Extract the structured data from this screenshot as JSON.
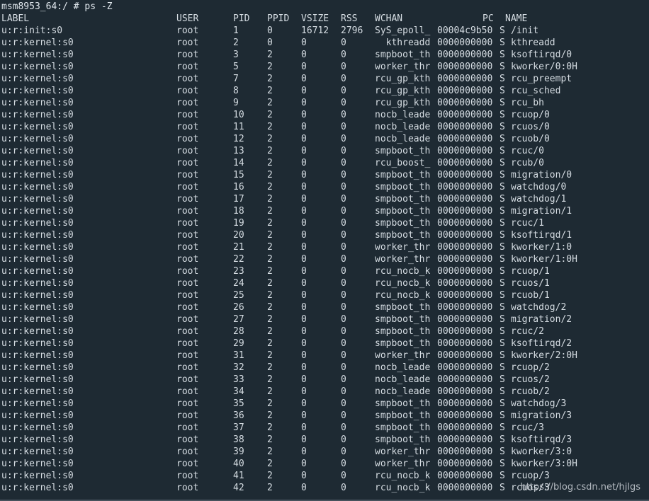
{
  "terminal": {
    "prompt": "msm8953_64:/ # ps -Z",
    "headers": {
      "label": "LABEL",
      "user": "USER",
      "pid": "PID",
      "ppid": "PPID",
      "vsize": "VSIZE",
      "rss": "RSS",
      "wchan": "WCHAN",
      "pc": "PC",
      "name": "NAME"
    },
    "rows": [
      {
        "label": "u:r:init:s0",
        "user": "root",
        "pid": "1",
        "ppid": "0",
        "vsize": "16712",
        "rss": "2796",
        "wchan": "SyS_epoll_",
        "pc": "00004c9b50",
        "state": "S",
        "name": "/init"
      },
      {
        "label": "u:r:kernel:s0",
        "user": "root",
        "pid": "2",
        "ppid": "0",
        "vsize": "0",
        "rss": "0",
        "wchan": "  kthreadd",
        "pc": "0000000000",
        "state": "S",
        "name": "kthreadd"
      },
      {
        "label": "u:r:kernel:s0",
        "user": "root",
        "pid": "3",
        "ppid": "2",
        "vsize": "0",
        "rss": "0",
        "wchan": "smpboot_th",
        "pc": "0000000000",
        "state": "S",
        "name": "ksoftirqd/0"
      },
      {
        "label": "u:r:kernel:s0",
        "user": "root",
        "pid": "5",
        "ppid": "2",
        "vsize": "0",
        "rss": "0",
        "wchan": "worker_thr",
        "pc": "0000000000",
        "state": "S",
        "name": "kworker/0:0H"
      },
      {
        "label": "u:r:kernel:s0",
        "user": "root",
        "pid": "7",
        "ppid": "2",
        "vsize": "0",
        "rss": "0",
        "wchan": "rcu_gp_kth",
        "pc": "0000000000",
        "state": "S",
        "name": "rcu_preempt"
      },
      {
        "label": "u:r:kernel:s0",
        "user": "root",
        "pid": "8",
        "ppid": "2",
        "vsize": "0",
        "rss": "0",
        "wchan": "rcu_gp_kth",
        "pc": "0000000000",
        "state": "S",
        "name": "rcu_sched"
      },
      {
        "label": "u:r:kernel:s0",
        "user": "root",
        "pid": "9",
        "ppid": "2",
        "vsize": "0",
        "rss": "0",
        "wchan": "rcu_gp_kth",
        "pc": "0000000000",
        "state": "S",
        "name": "rcu_bh"
      },
      {
        "label": "u:r:kernel:s0",
        "user": "root",
        "pid": "10",
        "ppid": "2",
        "vsize": "0",
        "rss": "0",
        "wchan": "nocb_leade",
        "pc": "0000000000",
        "state": "S",
        "name": "rcuop/0"
      },
      {
        "label": "u:r:kernel:s0",
        "user": "root",
        "pid": "11",
        "ppid": "2",
        "vsize": "0",
        "rss": "0",
        "wchan": "nocb_leade",
        "pc": "0000000000",
        "state": "S",
        "name": "rcuos/0"
      },
      {
        "label": "u:r:kernel:s0",
        "user": "root",
        "pid": "12",
        "ppid": "2",
        "vsize": "0",
        "rss": "0",
        "wchan": "nocb_leade",
        "pc": "0000000000",
        "state": "S",
        "name": "rcuob/0"
      },
      {
        "label": "u:r:kernel:s0",
        "user": "root",
        "pid": "13",
        "ppid": "2",
        "vsize": "0",
        "rss": "0",
        "wchan": "smpboot_th",
        "pc": "0000000000",
        "state": "S",
        "name": "rcuc/0"
      },
      {
        "label": "u:r:kernel:s0",
        "user": "root",
        "pid": "14",
        "ppid": "2",
        "vsize": "0",
        "rss": "0",
        "wchan": "rcu_boost_",
        "pc": "0000000000",
        "state": "S",
        "name": "rcub/0"
      },
      {
        "label": "u:r:kernel:s0",
        "user": "root",
        "pid": "15",
        "ppid": "2",
        "vsize": "0",
        "rss": "0",
        "wchan": "smpboot_th",
        "pc": "0000000000",
        "state": "S",
        "name": "migration/0"
      },
      {
        "label": "u:r:kernel:s0",
        "user": "root",
        "pid": "16",
        "ppid": "2",
        "vsize": "0",
        "rss": "0",
        "wchan": "smpboot_th",
        "pc": "0000000000",
        "state": "S",
        "name": "watchdog/0"
      },
      {
        "label": "u:r:kernel:s0",
        "user": "root",
        "pid": "17",
        "ppid": "2",
        "vsize": "0",
        "rss": "0",
        "wchan": "smpboot_th",
        "pc": "0000000000",
        "state": "S",
        "name": "watchdog/1"
      },
      {
        "label": "u:r:kernel:s0",
        "user": "root",
        "pid": "18",
        "ppid": "2",
        "vsize": "0",
        "rss": "0",
        "wchan": "smpboot_th",
        "pc": "0000000000",
        "state": "S",
        "name": "migration/1"
      },
      {
        "label": "u:r:kernel:s0",
        "user": "root",
        "pid": "19",
        "ppid": "2",
        "vsize": "0",
        "rss": "0",
        "wchan": "smpboot_th",
        "pc": "0000000000",
        "state": "S",
        "name": "rcuc/1"
      },
      {
        "label": "u:r:kernel:s0",
        "user": "root",
        "pid": "20",
        "ppid": "2",
        "vsize": "0",
        "rss": "0",
        "wchan": "smpboot_th",
        "pc": "0000000000",
        "state": "S",
        "name": "ksoftirqd/1"
      },
      {
        "label": "u:r:kernel:s0",
        "user": "root",
        "pid": "21",
        "ppid": "2",
        "vsize": "0",
        "rss": "0",
        "wchan": "worker_thr",
        "pc": "0000000000",
        "state": "S",
        "name": "kworker/1:0"
      },
      {
        "label": "u:r:kernel:s0",
        "user": "root",
        "pid": "22",
        "ppid": "2",
        "vsize": "0",
        "rss": "0",
        "wchan": "worker_thr",
        "pc": "0000000000",
        "state": "S",
        "name": "kworker/1:0H"
      },
      {
        "label": "u:r:kernel:s0",
        "user": "root",
        "pid": "23",
        "ppid": "2",
        "vsize": "0",
        "rss": "0",
        "wchan": "rcu_nocb_k",
        "pc": "0000000000",
        "state": "S",
        "name": "rcuop/1"
      },
      {
        "label": "u:r:kernel:s0",
        "user": "root",
        "pid": "24",
        "ppid": "2",
        "vsize": "0",
        "rss": "0",
        "wchan": "rcu_nocb_k",
        "pc": "0000000000",
        "state": "S",
        "name": "rcuos/1"
      },
      {
        "label": "u:r:kernel:s0",
        "user": "root",
        "pid": "25",
        "ppid": "2",
        "vsize": "0",
        "rss": "0",
        "wchan": "rcu_nocb_k",
        "pc": "0000000000",
        "state": "S",
        "name": "rcuob/1"
      },
      {
        "label": "u:r:kernel:s0",
        "user": "root",
        "pid": "26",
        "ppid": "2",
        "vsize": "0",
        "rss": "0",
        "wchan": "smpboot_th",
        "pc": "0000000000",
        "state": "S",
        "name": "watchdog/2"
      },
      {
        "label": "u:r:kernel:s0",
        "user": "root",
        "pid": "27",
        "ppid": "2",
        "vsize": "0",
        "rss": "0",
        "wchan": "smpboot_th",
        "pc": "0000000000",
        "state": "S",
        "name": "migration/2"
      },
      {
        "label": "u:r:kernel:s0",
        "user": "root",
        "pid": "28",
        "ppid": "2",
        "vsize": "0",
        "rss": "0",
        "wchan": "smpboot_th",
        "pc": "0000000000",
        "state": "S",
        "name": "rcuc/2"
      },
      {
        "label": "u:r:kernel:s0",
        "user": "root",
        "pid": "29",
        "ppid": "2",
        "vsize": "0",
        "rss": "0",
        "wchan": "smpboot_th",
        "pc": "0000000000",
        "state": "S",
        "name": "ksoftirqd/2"
      },
      {
        "label": "u:r:kernel:s0",
        "user": "root",
        "pid": "31",
        "ppid": "2",
        "vsize": "0",
        "rss": "0",
        "wchan": "worker_thr",
        "pc": "0000000000",
        "state": "S",
        "name": "kworker/2:0H"
      },
      {
        "label": "u:r:kernel:s0",
        "user": "root",
        "pid": "32",
        "ppid": "2",
        "vsize": "0",
        "rss": "0",
        "wchan": "nocb_leade",
        "pc": "0000000000",
        "state": "S",
        "name": "rcuop/2"
      },
      {
        "label": "u:r:kernel:s0",
        "user": "root",
        "pid": "33",
        "ppid": "2",
        "vsize": "0",
        "rss": "0",
        "wchan": "nocb_leade",
        "pc": "0000000000",
        "state": "S",
        "name": "rcuos/2"
      },
      {
        "label": "u:r:kernel:s0",
        "user": "root",
        "pid": "34",
        "ppid": "2",
        "vsize": "0",
        "rss": "0",
        "wchan": "nocb_leade",
        "pc": "0000000000",
        "state": "S",
        "name": "rcuob/2"
      },
      {
        "label": "u:r:kernel:s0",
        "user": "root",
        "pid": "35",
        "ppid": "2",
        "vsize": "0",
        "rss": "0",
        "wchan": "smpboot_th",
        "pc": "0000000000",
        "state": "S",
        "name": "watchdog/3"
      },
      {
        "label": "u:r:kernel:s0",
        "user": "root",
        "pid": "36",
        "ppid": "2",
        "vsize": "0",
        "rss": "0",
        "wchan": "smpboot_th",
        "pc": "0000000000",
        "state": "S",
        "name": "migration/3"
      },
      {
        "label": "u:r:kernel:s0",
        "user": "root",
        "pid": "37",
        "ppid": "2",
        "vsize": "0",
        "rss": "0",
        "wchan": "smpboot_th",
        "pc": "0000000000",
        "state": "S",
        "name": "rcuc/3"
      },
      {
        "label": "u:r:kernel:s0",
        "user": "root",
        "pid": "38",
        "ppid": "2",
        "vsize": "0",
        "rss": "0",
        "wchan": "smpboot_th",
        "pc": "0000000000",
        "state": "S",
        "name": "ksoftirqd/3"
      },
      {
        "label": "u:r:kernel:s0",
        "user": "root",
        "pid": "39",
        "ppid": "2",
        "vsize": "0",
        "rss": "0",
        "wchan": "worker_thr",
        "pc": "0000000000",
        "state": "S",
        "name": "kworker/3:0"
      },
      {
        "label": "u:r:kernel:s0",
        "user": "root",
        "pid": "40",
        "ppid": "2",
        "vsize": "0",
        "rss": "0",
        "wchan": "worker_thr",
        "pc": "0000000000",
        "state": "S",
        "name": "kworker/3:0H"
      },
      {
        "label": "u:r:kernel:s0",
        "user": "root",
        "pid": "41",
        "ppid": "2",
        "vsize": "0",
        "rss": "0",
        "wchan": "rcu_nocb_k",
        "pc": "0000000000",
        "state": "S",
        "name": "rcuop/3"
      },
      {
        "label": "u:r:kernel:s0",
        "user": "root",
        "pid": "42",
        "ppid": "2",
        "vsize": "0",
        "rss": "0",
        "wchan": "rcu_nocb_k",
        "pc": "0000000000",
        "state": "S",
        "name": "rcuos/3"
      }
    ]
  },
  "watermark": "https://blog.csdn.net/hjlgs",
  "colors": {
    "background": "#1e2a33",
    "text": "#d6dde3"
  }
}
